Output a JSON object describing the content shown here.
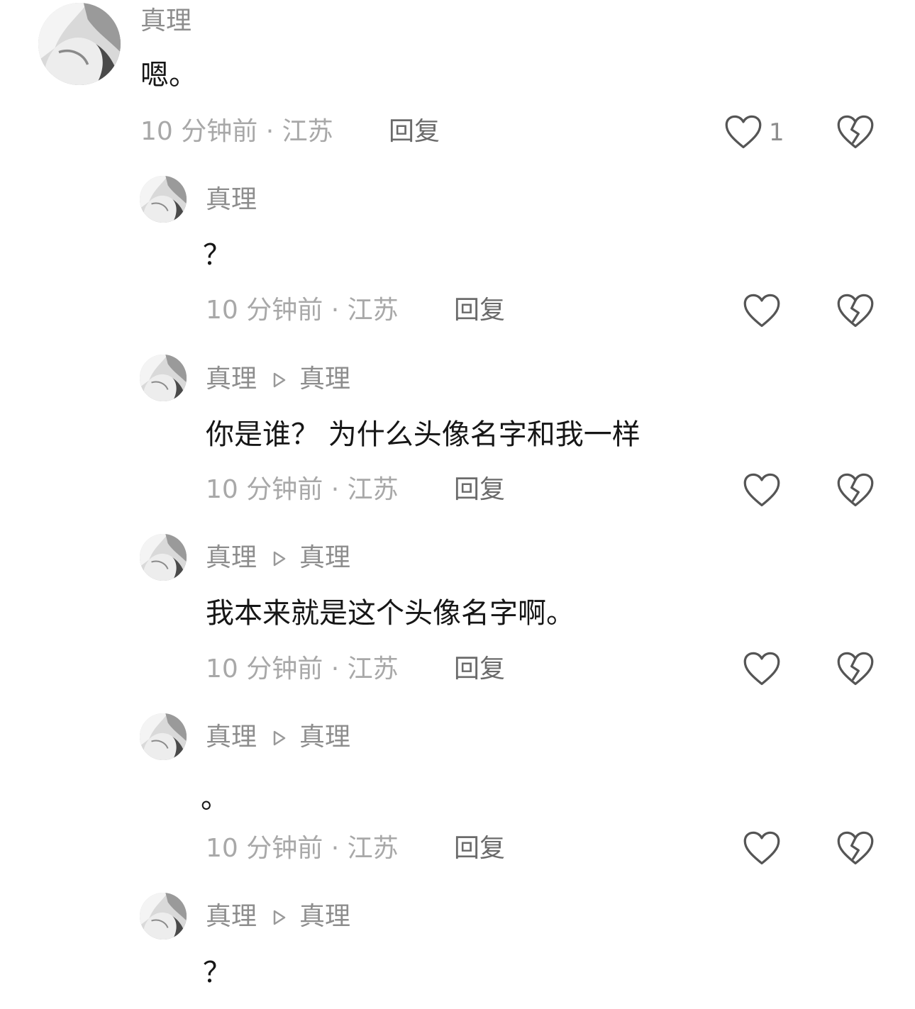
{
  "comments": [
    {
      "author": "真理",
      "reply_to": "",
      "text": "嗯。",
      "time": "10 分钟前 · 江苏",
      "reply_label": "回复",
      "like_count": "1",
      "like_icon": "heart-outline-icon",
      "dislike_icon": "broken-heart-icon"
    },
    {
      "author": "真理",
      "reply_to": "",
      "text": "？",
      "time": "10 分钟前 · 江苏",
      "reply_label": "回复",
      "like_count": "",
      "like_icon": "heart-outline-icon",
      "dislike_icon": "broken-heart-icon"
    },
    {
      "author": "真理",
      "reply_to": "真理",
      "text": "你是谁？ 为什么头像名字和我一样",
      "time": "10 分钟前 · 江苏",
      "reply_label": "回复",
      "like_count": "",
      "like_icon": "heart-outline-icon",
      "dislike_icon": "broken-heart-icon"
    },
    {
      "author": "真理",
      "reply_to": "真理",
      "text": "我本来就是这个头像名字啊。",
      "time": "10 分钟前 · 江苏",
      "reply_label": "回复",
      "like_count": "",
      "like_icon": "heart-outline-icon",
      "dislike_icon": "broken-heart-icon"
    },
    {
      "author": "真理",
      "reply_to": "真理",
      "text": "。",
      "time": "10 分钟前 · 江苏",
      "reply_label": "回复",
      "like_count": "",
      "like_icon": "heart-outline-icon",
      "dislike_icon": "broken-heart-icon"
    },
    {
      "author": "真理",
      "reply_to": "真理",
      "text": "？",
      "time": "",
      "reply_label": "",
      "like_count": "",
      "like_icon": "",
      "dislike_icon": ""
    }
  ],
  "colors": {
    "name": "#8d8d8d",
    "text": "#161616",
    "meta": "#a8a8a8",
    "reply": "#6b6b6b",
    "icon": "#555555"
  }
}
